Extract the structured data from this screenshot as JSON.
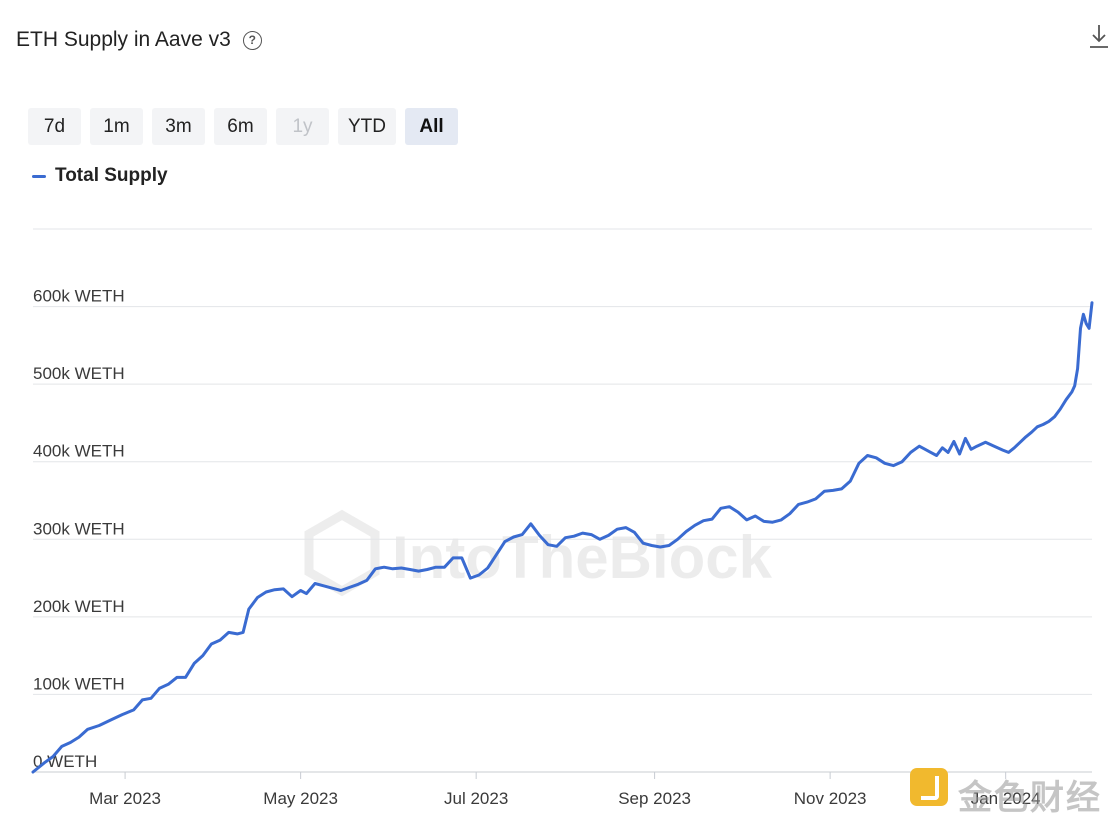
{
  "header": {
    "title": "ETH Supply in Aave v3",
    "help_icon": "question-circle-icon",
    "download_icon": "download-icon"
  },
  "ranges": [
    {
      "label": "7d",
      "state": "normal"
    },
    {
      "label": "1m",
      "state": "normal"
    },
    {
      "label": "3m",
      "state": "normal"
    },
    {
      "label": "6m",
      "state": "normal"
    },
    {
      "label": "1y",
      "state": "disabled"
    },
    {
      "label": "YTD",
      "state": "normal"
    },
    {
      "label": "All",
      "state": "active"
    }
  ],
  "watermarks": {
    "center": "IntoTheBlock",
    "corner": "金色财经"
  },
  "colors": {
    "series": "#3a6bd1",
    "grid": "#e3e5e8",
    "axis_text": "#3a3a3a"
  },
  "chart_data": {
    "type": "line",
    "title": "ETH Supply in Aave v3",
    "xlabel": "",
    "ylabel": "",
    "x_range": [
      "2023-01-28",
      "2024-01-31"
    ],
    "ylim": [
      0,
      700000
    ],
    "y_ticks": [
      {
        "value": 0,
        "label": "0 WETH"
      },
      {
        "value": 100000,
        "label": "100k WETH"
      },
      {
        "value": 200000,
        "label": "200k WETH"
      },
      {
        "value": 300000,
        "label": "300k WETH"
      },
      {
        "value": 400000,
        "label": "400k WETH"
      },
      {
        "value": 500000,
        "label": "500k WETH"
      },
      {
        "value": 600000,
        "label": "600k WETH"
      },
      {
        "value": 700000,
        "label": ""
      }
    ],
    "x_ticks": [
      {
        "date": "2023-03-01",
        "label": "Mar 2023"
      },
      {
        "date": "2023-05-01",
        "label": "May 2023"
      },
      {
        "date": "2023-07-01",
        "label": "Jul 2023"
      },
      {
        "date": "2023-09-01",
        "label": "Sep 2023"
      },
      {
        "date": "2023-11-01",
        "label": "Nov 2023"
      },
      {
        "date": "2024-01-01",
        "label": "Jan 2024"
      }
    ],
    "grid": true,
    "legend": "top-left",
    "series": [
      {
        "name": "Total Supply",
        "color": "#3a6bd1",
        "points": [
          [
            "2023-01-28",
            0
          ],
          [
            "2023-02-01",
            12000
          ],
          [
            "2023-02-04",
            20000
          ],
          [
            "2023-02-07",
            33000
          ],
          [
            "2023-02-10",
            38000
          ],
          [
            "2023-02-13",
            45000
          ],
          [
            "2023-02-16",
            55000
          ],
          [
            "2023-02-20",
            60000
          ],
          [
            "2023-02-24",
            67000
          ],
          [
            "2023-02-28",
            74000
          ],
          [
            "2023-03-04",
            80000
          ],
          [
            "2023-03-07",
            93000
          ],
          [
            "2023-03-10",
            95000
          ],
          [
            "2023-03-13",
            108000
          ],
          [
            "2023-03-16",
            113000
          ],
          [
            "2023-03-19",
            122000
          ],
          [
            "2023-03-22",
            122000
          ],
          [
            "2023-03-25",
            140000
          ],
          [
            "2023-03-28",
            150000
          ],
          [
            "2023-03-31",
            165000
          ],
          [
            "2023-04-03",
            170000
          ],
          [
            "2023-04-06",
            180000
          ],
          [
            "2023-04-09",
            178000
          ],
          [
            "2023-04-11",
            180000
          ],
          [
            "2023-04-13",
            210000
          ],
          [
            "2023-04-16",
            225000
          ],
          [
            "2023-04-19",
            232000
          ],
          [
            "2023-04-22",
            235000
          ],
          [
            "2023-04-25",
            236000
          ],
          [
            "2023-04-28",
            226000
          ],
          [
            "2023-05-01",
            234000
          ],
          [
            "2023-05-03",
            230000
          ],
          [
            "2023-05-06",
            243000
          ],
          [
            "2023-05-09",
            240000
          ],
          [
            "2023-05-12",
            237000
          ],
          [
            "2023-05-15",
            234000
          ],
          [
            "2023-05-18",
            238000
          ],
          [
            "2023-05-21",
            242000
          ],
          [
            "2023-05-24",
            247000
          ],
          [
            "2023-05-27",
            262000
          ],
          [
            "2023-05-30",
            264000
          ],
          [
            "2023-06-02",
            262000
          ],
          [
            "2023-06-05",
            263000
          ],
          [
            "2023-06-08",
            261000
          ],
          [
            "2023-06-11",
            259000
          ],
          [
            "2023-06-14",
            261000
          ],
          [
            "2023-06-17",
            264000
          ],
          [
            "2023-06-20",
            264000
          ],
          [
            "2023-06-23",
            276000
          ],
          [
            "2023-06-26",
            276000
          ],
          [
            "2023-06-29",
            250000
          ],
          [
            "2023-07-02",
            254000
          ],
          [
            "2023-07-05",
            263000
          ],
          [
            "2023-07-08",
            280000
          ],
          [
            "2023-07-11",
            297000
          ],
          [
            "2023-07-14",
            303000
          ],
          [
            "2023-07-17",
            306000
          ],
          [
            "2023-07-20",
            320000
          ],
          [
            "2023-07-23",
            305000
          ],
          [
            "2023-07-26",
            293000
          ],
          [
            "2023-07-29",
            291000
          ],
          [
            "2023-08-01",
            302000
          ],
          [
            "2023-08-04",
            304000
          ],
          [
            "2023-08-07",
            308000
          ],
          [
            "2023-08-10",
            306000
          ],
          [
            "2023-08-13",
            300000
          ],
          [
            "2023-08-16",
            305000
          ],
          [
            "2023-08-19",
            313000
          ],
          [
            "2023-08-22",
            315000
          ],
          [
            "2023-08-25",
            309000
          ],
          [
            "2023-08-28",
            295000
          ],
          [
            "2023-08-31",
            292000
          ],
          [
            "2023-09-03",
            290000
          ],
          [
            "2023-09-06",
            292000
          ],
          [
            "2023-09-09",
            300000
          ],
          [
            "2023-09-12",
            310000
          ],
          [
            "2023-09-15",
            318000
          ],
          [
            "2023-09-18",
            324000
          ],
          [
            "2023-09-21",
            326000
          ],
          [
            "2023-09-24",
            340000
          ],
          [
            "2023-09-27",
            342000
          ],
          [
            "2023-09-30",
            335000
          ],
          [
            "2023-10-03",
            325000
          ],
          [
            "2023-10-06",
            330000
          ],
          [
            "2023-10-09",
            323000
          ],
          [
            "2023-10-12",
            322000
          ],
          [
            "2023-10-15",
            325000
          ],
          [
            "2023-10-18",
            333000
          ],
          [
            "2023-10-21",
            345000
          ],
          [
            "2023-10-24",
            348000
          ],
          [
            "2023-10-27",
            352000
          ],
          [
            "2023-10-30",
            362000
          ],
          [
            "2023-11-02",
            363000
          ],
          [
            "2023-11-05",
            365000
          ],
          [
            "2023-11-08",
            375000
          ],
          [
            "2023-11-11",
            398000
          ],
          [
            "2023-11-14",
            408000
          ],
          [
            "2023-11-17",
            405000
          ],
          [
            "2023-11-20",
            398000
          ],
          [
            "2023-11-23",
            395000
          ],
          [
            "2023-11-26",
            400000
          ],
          [
            "2023-11-29",
            412000
          ],
          [
            "2023-12-02",
            420000
          ],
          [
            "2023-12-04",
            416000
          ],
          [
            "2023-12-06",
            412000
          ],
          [
            "2023-12-08",
            408000
          ],
          [
            "2023-12-10",
            418000
          ],
          [
            "2023-12-12",
            412000
          ],
          [
            "2023-12-14",
            426000
          ],
          [
            "2023-12-16",
            410000
          ],
          [
            "2023-12-18",
            430000
          ],
          [
            "2023-12-20",
            416000
          ],
          [
            "2023-12-22",
            420000
          ],
          [
            "2023-12-25",
            425000
          ],
          [
            "2023-12-28",
            420000
          ],
          [
            "2023-12-31",
            415000
          ],
          [
            "2024-01-02",
            412000
          ],
          [
            "2024-01-04",
            418000
          ],
          [
            "2024-01-06",
            425000
          ],
          [
            "2024-01-08",
            432000
          ],
          [
            "2024-01-10",
            438000
          ],
          [
            "2024-01-12",
            445000
          ],
          [
            "2024-01-14",
            448000
          ],
          [
            "2024-01-16",
            452000
          ],
          [
            "2024-01-18",
            458000
          ],
          [
            "2024-01-20",
            468000
          ],
          [
            "2024-01-22",
            480000
          ],
          [
            "2024-01-24",
            490000
          ],
          [
            "2024-01-25",
            498000
          ],
          [
            "2024-01-26",
            520000
          ],
          [
            "2024-01-27",
            572000
          ],
          [
            "2024-01-28",
            590000
          ],
          [
            "2024-01-29",
            578000
          ],
          [
            "2024-01-30",
            572000
          ],
          [
            "2024-01-31",
            605000
          ]
        ]
      }
    ]
  }
}
